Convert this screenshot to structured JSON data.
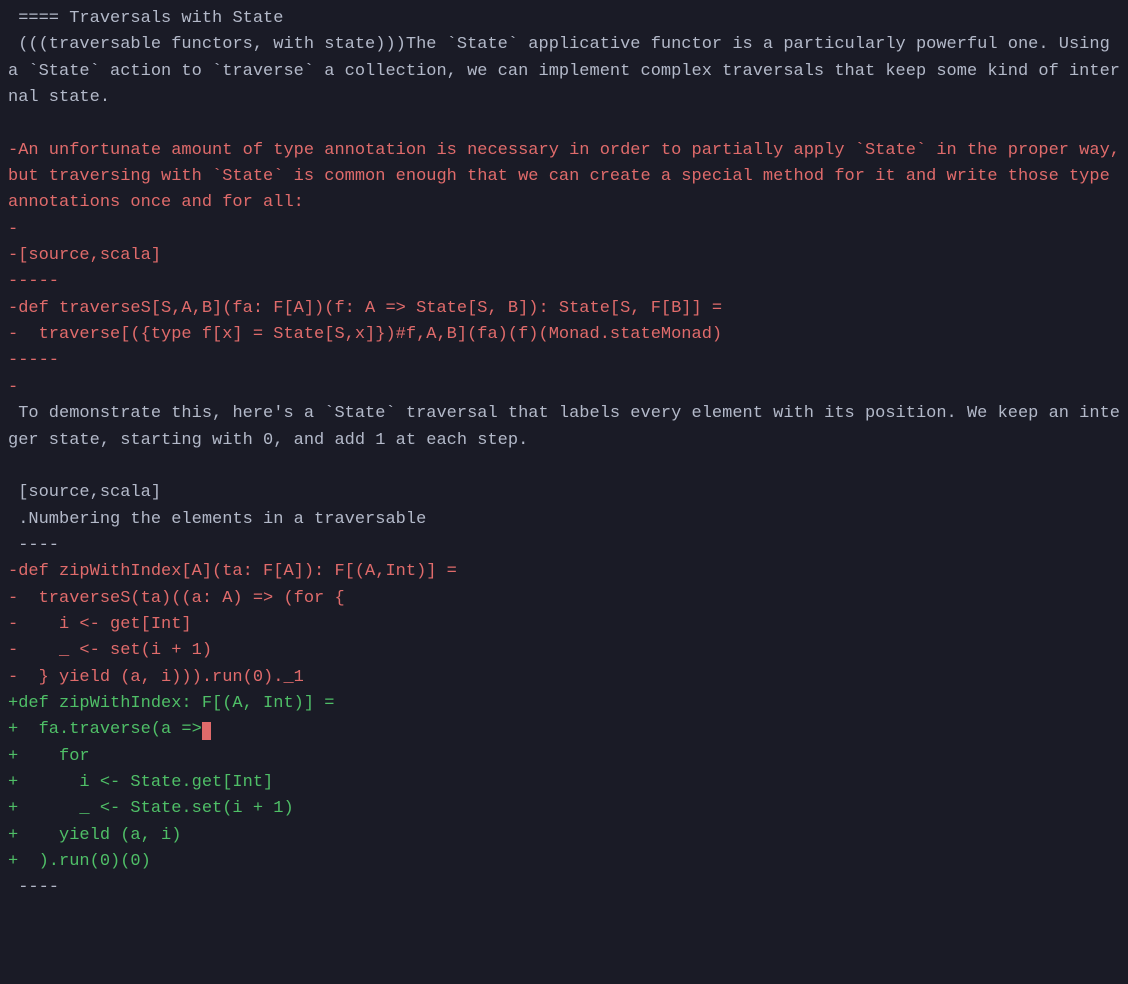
{
  "diff": {
    "lines": [
      {
        "type": "ctx",
        "text": " ==== Traversals with State"
      },
      {
        "type": "ctx",
        "text": " (((traversable functors, with state)))The `State` applicative functor is a particularly powerful one. Using a `State` action to `traverse` a collection, we can implement complex traversals that keep some kind of internal state."
      },
      {
        "type": "ctx",
        "text": " "
      },
      {
        "type": "del",
        "text": "-An unfortunate amount of type annotation is necessary in order to partially apply `State` in the proper way, but traversing with `State` is common enough that we can create a special method for it and write those type annotations once and for all:"
      },
      {
        "type": "del",
        "text": "-"
      },
      {
        "type": "del",
        "text": "-[source,scala]"
      },
      {
        "type": "del",
        "text": "-----"
      },
      {
        "type": "del",
        "text": "-def traverseS[S,A,B](fa: F[A])(f: A => State[S, B]): State[S, F[B]] ="
      },
      {
        "type": "del",
        "text": "-  traverse[({type f[x] = State[S,x]})#f,A,B](fa)(f)(Monad.stateMonad)"
      },
      {
        "type": "del",
        "text": "-----"
      },
      {
        "type": "del",
        "text": "-"
      },
      {
        "type": "ctx",
        "text": " To demonstrate this, here's a `State` traversal that labels every element with its position. We keep an integer state, starting with 0, and add 1 at each step."
      },
      {
        "type": "ctx",
        "text": " "
      },
      {
        "type": "ctx",
        "text": " [source,scala]"
      },
      {
        "type": "ctx",
        "text": " .Numbering the elements in a traversable"
      },
      {
        "type": "ctx",
        "text": " ----"
      },
      {
        "type": "del",
        "text": "-def zipWithIndex[A](ta: F[A]): F[(A,Int)] ="
      },
      {
        "type": "del",
        "text": "-  traverseS(ta)((a: A) => (for {"
      },
      {
        "type": "del",
        "text": "-    i <- get[Int]"
      },
      {
        "type": "del",
        "text": "-    _ <- set(i + 1)"
      },
      {
        "type": "del",
        "text": "-  } yield (a, i))).run(0)._1"
      },
      {
        "type": "add",
        "text": "+def zipWithIndex: F[(A, Int)] ="
      },
      {
        "type": "add",
        "text": "+  fa.traverse(a =>",
        "cursor": true
      },
      {
        "type": "add",
        "text": "+    for"
      },
      {
        "type": "add",
        "text": "+      i <- State.get[Int]"
      },
      {
        "type": "add",
        "text": "+      _ <- State.set(i + 1)"
      },
      {
        "type": "add",
        "text": "+    yield (a, i)"
      },
      {
        "type": "add",
        "text": "+  ).run(0)(0)"
      },
      {
        "type": "ctx",
        "text": " ----"
      }
    ]
  }
}
